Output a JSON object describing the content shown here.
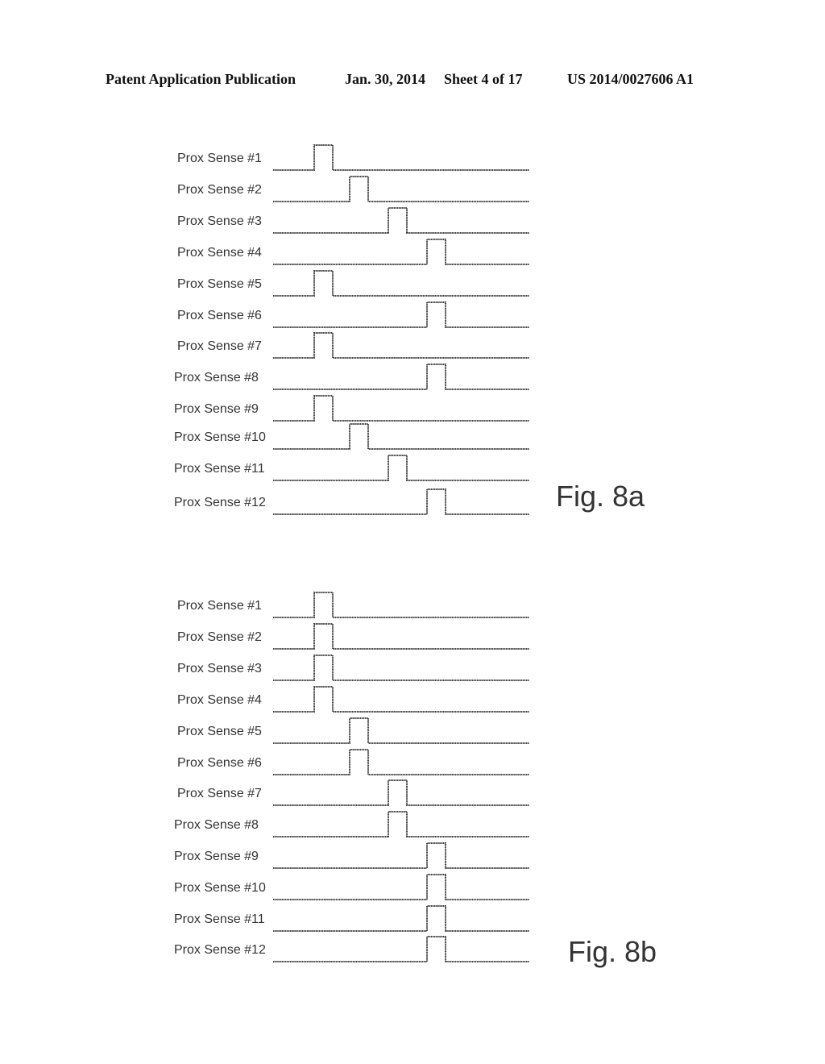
{
  "header": {
    "publication": "Patent Application Publication",
    "date": "Jan. 30, 2014",
    "sheet": "Sheet 4 of 17",
    "number": "US 2014/0027606 A1"
  },
  "figures": [
    {
      "id": "fig8a",
      "caption": "Fig. 8a",
      "signals": [
        {
          "label": "Prox Sense #1",
          "pulse_slot": 0
        },
        {
          "label": "Prox Sense #2",
          "pulse_slot": 1
        },
        {
          "label": "Prox Sense #3",
          "pulse_slot": 2
        },
        {
          "label": "Prox Sense #4",
          "pulse_slot": 3
        },
        {
          "label": "Prox Sense #5",
          "pulse_slot": 0
        },
        {
          "label": "Prox Sense #6",
          "pulse_slot": 3
        },
        {
          "label": "Prox Sense #7",
          "pulse_slot": 0
        },
        {
          "label": "Prox Sense #8",
          "pulse_slot": 3
        },
        {
          "label": "Prox Sense #9",
          "pulse_slot": 0
        },
        {
          "label": "Prox Sense #10",
          "pulse_slot": 1
        },
        {
          "label": "Prox Sense #11",
          "pulse_slot": 2
        },
        {
          "label": "Prox Sense #12",
          "pulse_slot": 3
        }
      ]
    },
    {
      "id": "fig8b",
      "caption": "Fig. 8b",
      "signals": [
        {
          "label": "Prox Sense #1",
          "pulse_slot": 0
        },
        {
          "label": "Prox Sense #2",
          "pulse_slot": 0
        },
        {
          "label": "Prox Sense #3",
          "pulse_slot": 0
        },
        {
          "label": "Prox Sense #4",
          "pulse_slot": 0
        },
        {
          "label": "Prox Sense #5",
          "pulse_slot": 1
        },
        {
          "label": "Prox Sense #6",
          "pulse_slot": 1
        },
        {
          "label": "Prox Sense #7",
          "pulse_slot": 2
        },
        {
          "label": "Prox Sense #8",
          "pulse_slot": 2
        },
        {
          "label": "Prox Sense #9",
          "pulse_slot": 3
        },
        {
          "label": "Prox Sense #10",
          "pulse_slot": 3
        },
        {
          "label": "Prox Sense #11",
          "pulse_slot": 3
        },
        {
          "label": "Prox Sense #12",
          "pulse_slot": 3
        }
      ]
    }
  ]
}
